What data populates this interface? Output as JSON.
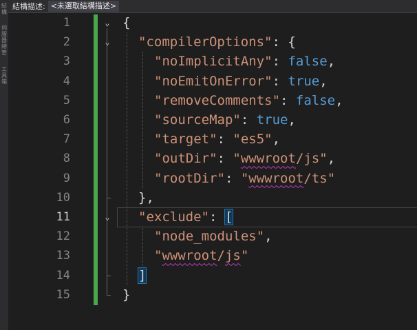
{
  "side_strip": {
    "glyphs": [
      "結構",
      "伺服器總管",
      "工具箱"
    ]
  },
  "topbar": {
    "label": "結構描述:",
    "selection": "<未選取結構描述>"
  },
  "editor": {
    "active_line": 11,
    "line_numbers": [
      "1",
      "2",
      "3",
      "4",
      "5",
      "6",
      "7",
      "8",
      "9",
      "10",
      "11",
      "12",
      "13",
      "14",
      "15"
    ],
    "lines": [
      {
        "indent": 0,
        "tokens": [
          {
            "t": "{",
            "c": "p"
          }
        ]
      },
      {
        "indent": 1,
        "tokens": [
          {
            "t": "\"compilerOptions\"",
            "c": "k"
          },
          {
            "t": ": {",
            "c": "p"
          }
        ]
      },
      {
        "indent": 2,
        "tokens": [
          {
            "t": "\"noImplicitAny\"",
            "c": "k"
          },
          {
            "t": ": ",
            "c": "p"
          },
          {
            "t": "false",
            "c": "kw"
          },
          {
            "t": ",",
            "c": "p"
          }
        ]
      },
      {
        "indent": 2,
        "tokens": [
          {
            "t": "\"noEmitOnError\"",
            "c": "k"
          },
          {
            "t": ": ",
            "c": "p"
          },
          {
            "t": "true",
            "c": "kw"
          },
          {
            "t": ",",
            "c": "p"
          }
        ]
      },
      {
        "indent": 2,
        "tokens": [
          {
            "t": "\"removeComments\"",
            "c": "k"
          },
          {
            "t": ": ",
            "c": "p"
          },
          {
            "t": "false",
            "c": "kw"
          },
          {
            "t": ",",
            "c": "p"
          }
        ]
      },
      {
        "indent": 2,
        "tokens": [
          {
            "t": "\"sourceMap\"",
            "c": "k"
          },
          {
            "t": ": ",
            "c": "p"
          },
          {
            "t": "true",
            "c": "kw"
          },
          {
            "t": ",",
            "c": "p"
          }
        ]
      },
      {
        "indent": 2,
        "tokens": [
          {
            "t": "\"target\"",
            "c": "k"
          },
          {
            "t": ": ",
            "c": "p"
          },
          {
            "t": "\"es5\"",
            "c": "s"
          },
          {
            "t": ",",
            "c": "p"
          }
        ]
      },
      {
        "indent": 2,
        "tokens": [
          {
            "t": "\"outDir\"",
            "c": "k"
          },
          {
            "t": ": ",
            "c": "p"
          },
          {
            "t": "\"",
            "c": "s"
          },
          {
            "t": "wwwroot",
            "c": "s squig"
          },
          {
            "t": "/js\"",
            "c": "s"
          },
          {
            "t": ",",
            "c": "p"
          }
        ]
      },
      {
        "indent": 2,
        "tokens": [
          {
            "t": "\"rootDir\"",
            "c": "k"
          },
          {
            "t": ": ",
            "c": "p"
          },
          {
            "t": "\"",
            "c": "s"
          },
          {
            "t": "wwwroot",
            "c": "s squig"
          },
          {
            "t": "/ts\"",
            "c": "s"
          }
        ]
      },
      {
        "indent": 1,
        "tokens": [
          {
            "t": "},",
            "c": "p"
          }
        ]
      },
      {
        "indent": 1,
        "tokens": [
          {
            "t": "\"exclude\"",
            "c": "k"
          },
          {
            "t": ": ",
            "c": "p"
          },
          {
            "t": "[",
            "c": "br"
          }
        ]
      },
      {
        "indent": 2,
        "tokens": [
          {
            "t": "\"node_modules\"",
            "c": "s"
          },
          {
            "t": ",",
            "c": "p"
          }
        ]
      },
      {
        "indent": 2,
        "tokens": [
          {
            "t": "\"",
            "c": "s"
          },
          {
            "t": "wwwroot",
            "c": "s squig"
          },
          {
            "t": "/",
            "c": "s"
          },
          {
            "t": "js",
            "c": "s squig"
          },
          {
            "t": "\"",
            "c": "s"
          }
        ]
      },
      {
        "indent": 1,
        "tokens": [
          {
            "t": "]",
            "c": "br"
          }
        ]
      },
      {
        "indent": 0,
        "tokens": [
          {
            "t": "}",
            "c": "p"
          }
        ]
      }
    ],
    "fold_markers": [
      {
        "line": 1,
        "symbol": "⌄"
      },
      {
        "line": 2,
        "symbol": "⌄"
      },
      {
        "line": 11,
        "symbol": "⌄"
      }
    ],
    "colors": {
      "background": "#1e1e1e",
      "string": "#ce9178",
      "keyword": "#569cd6",
      "change_bar": "#4ca64c",
      "squiggle": "#c63bc6"
    }
  }
}
